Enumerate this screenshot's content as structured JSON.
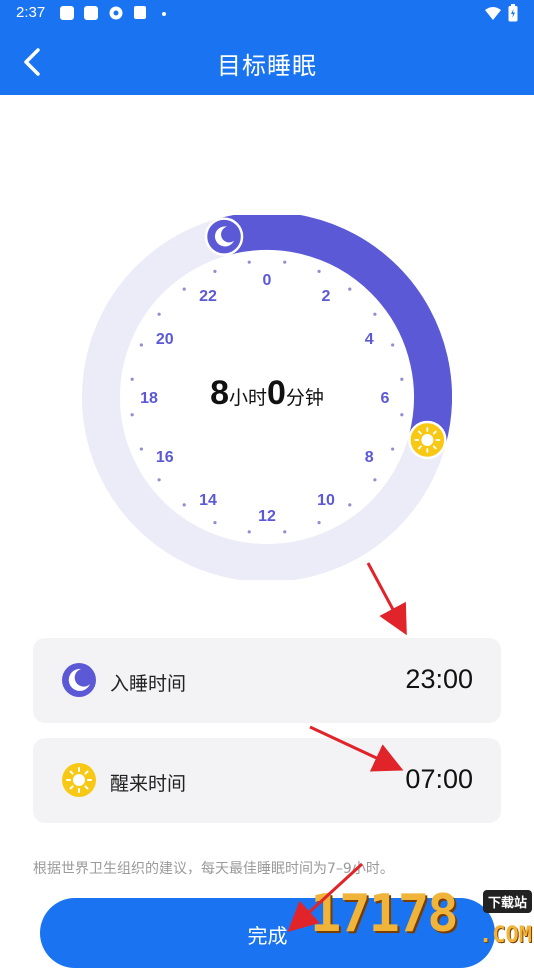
{
  "status": {
    "time": "2:37"
  },
  "header": {
    "title": "目标睡眠"
  },
  "dial": {
    "hour_labels": [
      "0",
      "2",
      "4",
      "6",
      "8",
      "10",
      "12",
      "14",
      "16",
      "18",
      "20",
      "22"
    ],
    "sleep_start_hour": 23,
    "wake_hour": 7,
    "accent_color": "#5b59d6",
    "track_color": "#ececf8",
    "sun_color": "#f7c814"
  },
  "duration": {
    "hours": "8",
    "hours_unit": "小时",
    "minutes": "0",
    "minutes_unit": "分钟"
  },
  "sleep_card": {
    "label": "入睡时间",
    "value": "23:00",
    "icon": "moon-icon"
  },
  "wake_card": {
    "label": "醒来时间",
    "value": "07:00",
    "icon": "sun-icon"
  },
  "note": "根据世界卫生组织的建议，每天最佳睡眠时间为7–9小时。",
  "done_button": {
    "label": "完成"
  },
  "watermark": {
    "number": "17178",
    "tag": "下载站",
    "suffix": ".COM"
  },
  "colors": {
    "primary": "#1a73f0",
    "card_bg": "#f3f3f5",
    "arrow": "#e0242a"
  }
}
